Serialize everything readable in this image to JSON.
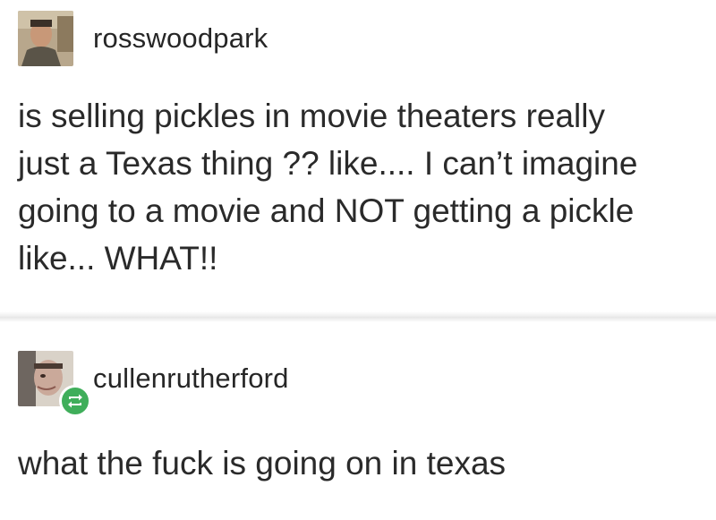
{
  "posts": [
    {
      "username": "rosswoodpark",
      "avatar_icon": "profile-photo-icon",
      "text": "is selling pickles in movie theaters really\njust a Texas thing ?? like.... I can’t imagine\ngoing to a movie and NOT getting a pickle\nlike... WHAT!!"
    },
    {
      "username": "cullenrutherford",
      "avatar_icon": "profile-photo-icon",
      "badge_icon": "reblog-icon",
      "text": "what the fuck is going on in texas"
    }
  ],
  "colors": {
    "reblog_badge": "#3fae5a",
    "text": "#2a2a2a"
  }
}
